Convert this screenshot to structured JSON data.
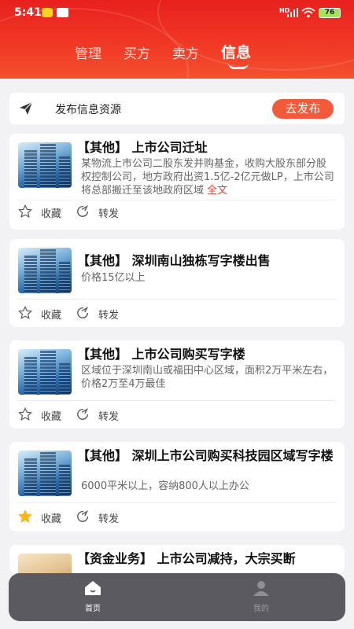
{
  "status": {
    "time": "5:41",
    "network": "HD",
    "battery": "76"
  },
  "tabs": [
    {
      "label": "管理"
    },
    {
      "label": "买方"
    },
    {
      "label": "卖方"
    },
    {
      "label": "信息",
      "active": true
    }
  ],
  "publish": {
    "label": "发布信息资源",
    "button": "去发布"
  },
  "cards": [
    {
      "title": "【其他】 上市公司迁址",
      "desc": "某物流上市公司二股东发并购基金，收购大股东部分股权控制公司，地方政府出资1.5亿-2亿元做LP，上市公司将总部搬迁至该地政府区域",
      "more": "全文",
      "favorite": "收藏",
      "forward": "转发",
      "favorited": false
    },
    {
      "title": "【其他】 深圳南山独栋写字楼出售",
      "desc": "价格15亿以上",
      "favorite": "收藏",
      "forward": "转发",
      "favorited": false
    },
    {
      "title": "【其他】 上市公司购买写字楼",
      "desc": "区域位于深圳南山或福田中心区域，面积2万平米左右，价格2万至4万最佳",
      "favorite": "收藏",
      "forward": "转发",
      "favorited": false
    },
    {
      "title": "【其他】 深圳上市公司购买科技园区域写字楼",
      "desc": "6000平米以上，容纳800人以上办公",
      "favorite": "收藏",
      "forward": "转发",
      "favorited": true
    },
    {
      "title": "【资金业务】 上市公司减持，大宗买断"
    }
  ],
  "nav": [
    {
      "label": "首页",
      "active": true
    },
    {
      "label": "我的",
      "active": false
    }
  ],
  "colors": {
    "brand": "#e8201e",
    "accent": "#f25a3b",
    "star_active": "#f5b81e"
  }
}
